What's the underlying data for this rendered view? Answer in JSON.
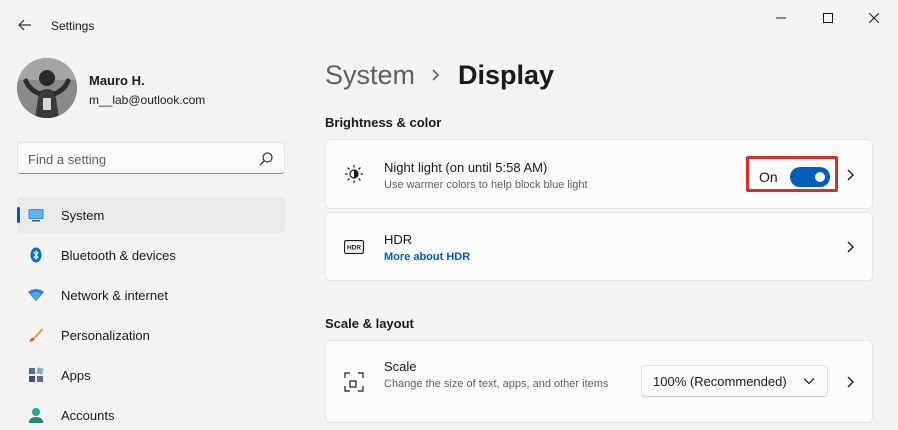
{
  "window": {
    "title": "Settings"
  },
  "profile": {
    "name": "Mauro H.",
    "email": "m__lab@outlook.com"
  },
  "search": {
    "placeholder": "Find a setting"
  },
  "sidebar": {
    "items": [
      {
        "label": "System",
        "icon": "system-icon",
        "selected": true
      },
      {
        "label": "Bluetooth & devices",
        "icon": "bluetooth-icon",
        "selected": false
      },
      {
        "label": "Network & internet",
        "icon": "wifi-icon",
        "selected": false
      },
      {
        "label": "Personalization",
        "icon": "brush-icon",
        "selected": false
      },
      {
        "label": "Apps",
        "icon": "apps-icon",
        "selected": false
      },
      {
        "label": "Accounts",
        "icon": "person-icon",
        "selected": false
      }
    ]
  },
  "breadcrumb": {
    "parent": "System",
    "current": "Display"
  },
  "sections": {
    "brightness": "Brightness & color",
    "scale_layout": "Scale & layout"
  },
  "night_light": {
    "title": "Night light (on until 5:58 AM)",
    "subtitle": "Use warmer colors to help block blue light",
    "toggle_label": "On",
    "toggle_on": true,
    "icon": "brightness-icon"
  },
  "hdr": {
    "title": "HDR",
    "link": "More about HDR",
    "icon": "hdr-icon"
  },
  "scale": {
    "title": "Scale",
    "subtitle": "Change the size of text, apps, and other items",
    "value": "100% (Recommended)",
    "icon": "scale-icon"
  },
  "colors": {
    "accent": "#005fb8",
    "highlight_border": "#d32f2f",
    "background": "#f3f3f3",
    "card": "#fbfbfb"
  }
}
